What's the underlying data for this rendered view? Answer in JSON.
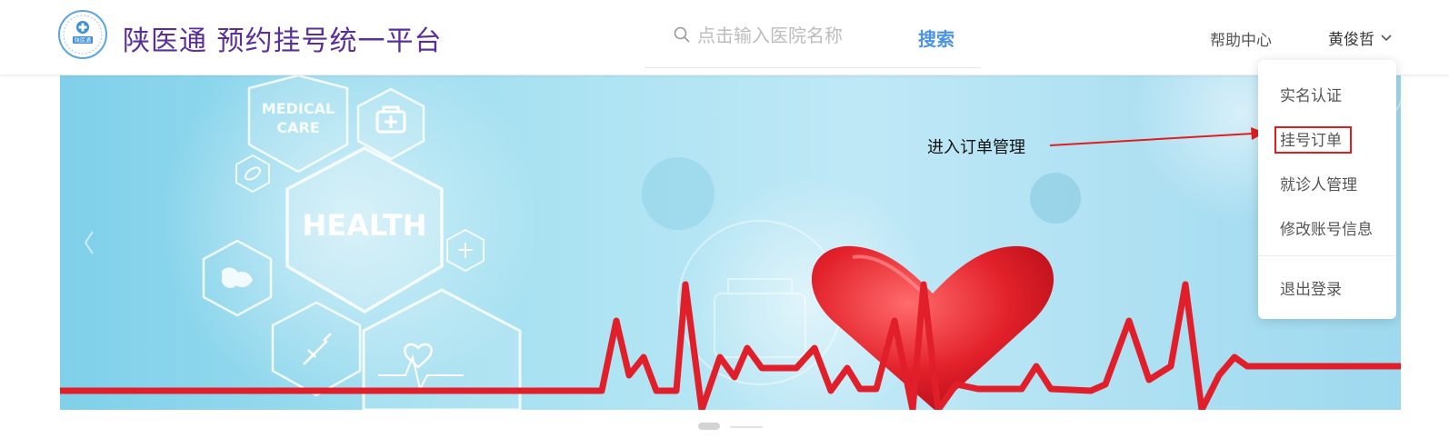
{
  "header": {
    "brand_title": "陕医通 预约挂号统一平台",
    "help_label": "帮助中心",
    "user_name": "黄俊哲"
  },
  "search": {
    "placeholder": "点击输入医院名称",
    "button_label": "搜索"
  },
  "user_menu": {
    "items": [
      "实名认证",
      "挂号订单",
      "就诊人管理",
      "修改账号信息"
    ],
    "logout_label": "退出登录",
    "highlighted_item": "挂号订单"
  },
  "annotation": {
    "text": "进入订单管理",
    "color": "#e01e1e"
  },
  "banner": {
    "hex_labels": [
      "MEDICAL",
      "CARE",
      "HEALTH"
    ]
  },
  "carousel": {
    "slide_count": 2,
    "active_slide": 1
  },
  "colors": {
    "brand": "#5a2f9c",
    "accent": "#4b93e6",
    "ecg_red": "#e11f2a"
  }
}
